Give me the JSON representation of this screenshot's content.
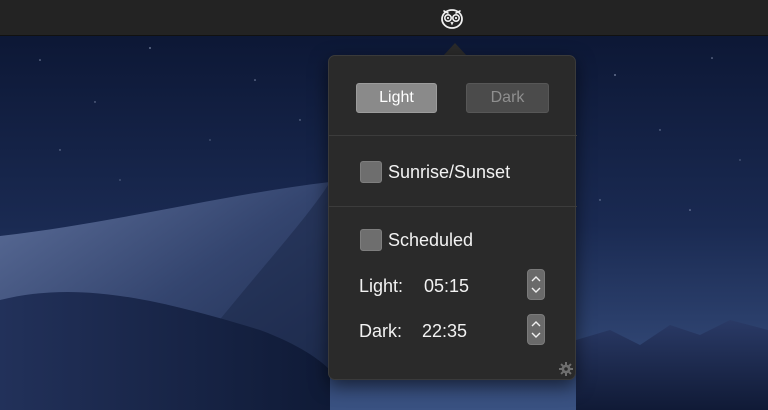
{
  "menubar": {
    "app_icon": "owl-icon"
  },
  "popover": {
    "appearance": {
      "light_label": "Light",
      "dark_label": "Dark",
      "selected": "Light"
    },
    "sunrise_sunset": {
      "label": "Sunrise/Sunset",
      "checked": false
    },
    "scheduled": {
      "label": "Scheduled",
      "checked": false,
      "light_label": "Light:",
      "light_time": "05:15",
      "dark_label": "Dark:",
      "dark_time": "22:35"
    },
    "settings_icon": "gear-icon"
  },
  "colors": {
    "menubar_bg": "#232323",
    "popover_bg": "#2a2a2a",
    "selected_button": "#8a8a8a",
    "unselected_button": "#4b4b4b"
  }
}
